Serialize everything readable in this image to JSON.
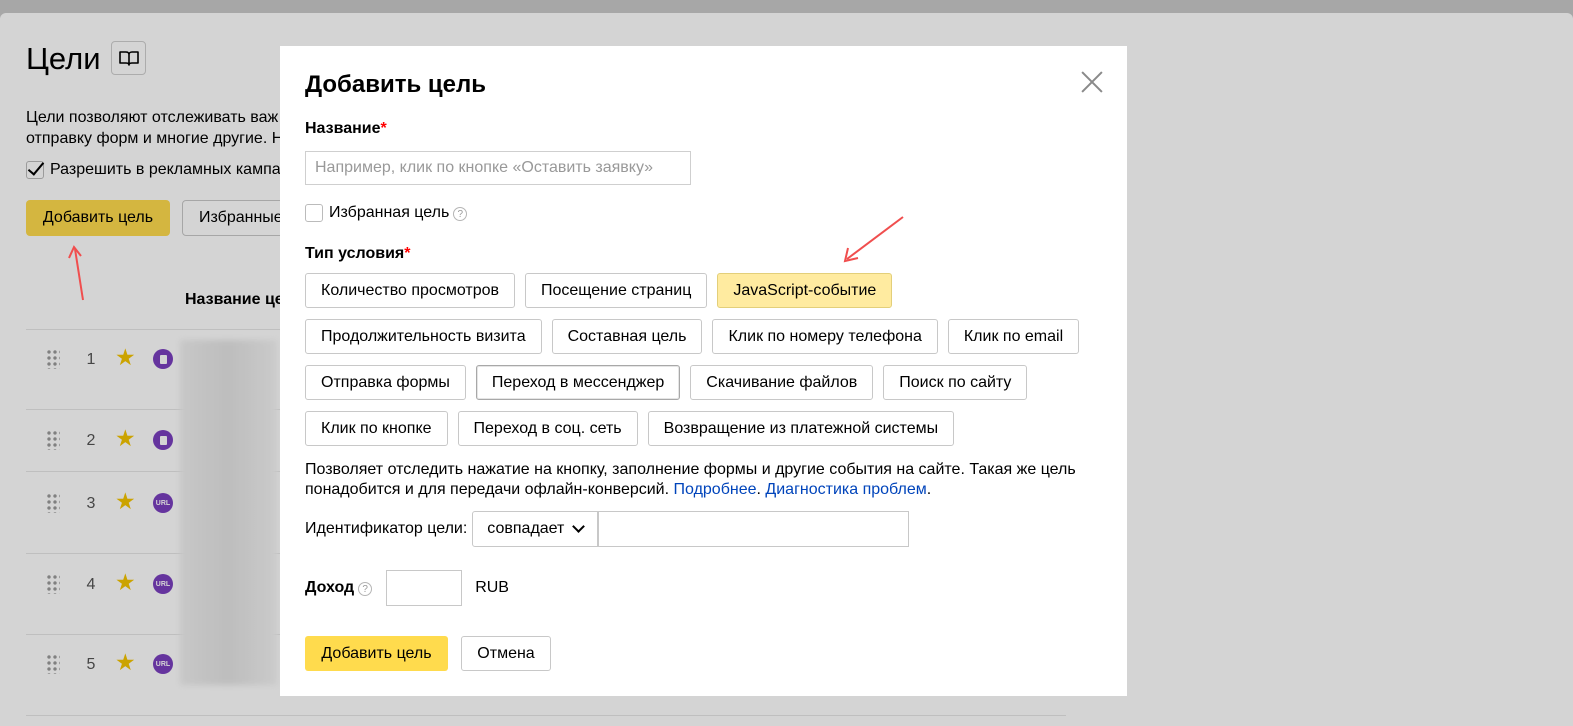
{
  "page": {
    "title": "Цели",
    "description": "Цели позволяют отслеживать важ\nотправку форм и многие другие. Н",
    "allow_label": "Разрешить в рекламных кампа",
    "add_goal_label": "Добавить цель",
    "favorites_label": "Избранные",
    "column_name_header": "Название це",
    "rows": [
      {
        "num": "1",
        "type": "doc"
      },
      {
        "num": "2",
        "type": "doc"
      },
      {
        "num": "3",
        "type": "URL"
      },
      {
        "num": "4",
        "type": "URL"
      },
      {
        "num": "5",
        "type": "URL"
      }
    ]
  },
  "modal": {
    "title": "Добавить цель",
    "name_label": "Название",
    "required_mark": "*",
    "name_placeholder": "Например, клик по кнопке «Оставить заявку»",
    "favorite_label": "Избранная цель",
    "help_glyph": "?",
    "condition_label": "Тип условия",
    "conditions": [
      "Количество просмотров",
      "Посещение страниц",
      "JavaScript-событие",
      "Продолжительность визита",
      "Составная цель",
      "Клик по номеру телефона",
      "Клик по email",
      "Отправка формы",
      "Переход в мессенджер",
      "Скачивание файлов",
      "Поиск по сайту",
      "Клик по кнопке",
      "Переход в соц. сеть",
      "Возвращение из платежной системы"
    ],
    "selected_condition": "JavaScript-событие",
    "hint_text": "Позволяет отследить нажатие на кнопку, заполнение формы и другие события на сайте. Такая же цель понадобится и для передачи офлайн-конверсий.",
    "hint_link_more": "Подробнее",
    "hint_link_diag": "Диагностика проблем",
    "hint_sep": ". ",
    "hint_end": ".",
    "id_label": "Идентификатор цели:",
    "match_value": "совпадает",
    "id_value": "",
    "income_label": "Доход",
    "income_value": "",
    "currency": "RUB",
    "submit_label": "Добавить цель",
    "cancel_label": "Отмена"
  },
  "colors": {
    "accent": "#ffdb4d",
    "selected": "#ffeba0",
    "link": "#0044bb",
    "required": "#ff0000",
    "badge": "#7a3fbf",
    "star": "#f5c400",
    "arrow": "#f04e4e"
  },
  "icons": [
    "book-icon",
    "check-icon",
    "drag-handle-icon",
    "star-icon",
    "doc-badge-icon",
    "url-badge-icon",
    "close-icon",
    "help-icon",
    "chevron-down-icon",
    "arrow-annotation-icon"
  ]
}
